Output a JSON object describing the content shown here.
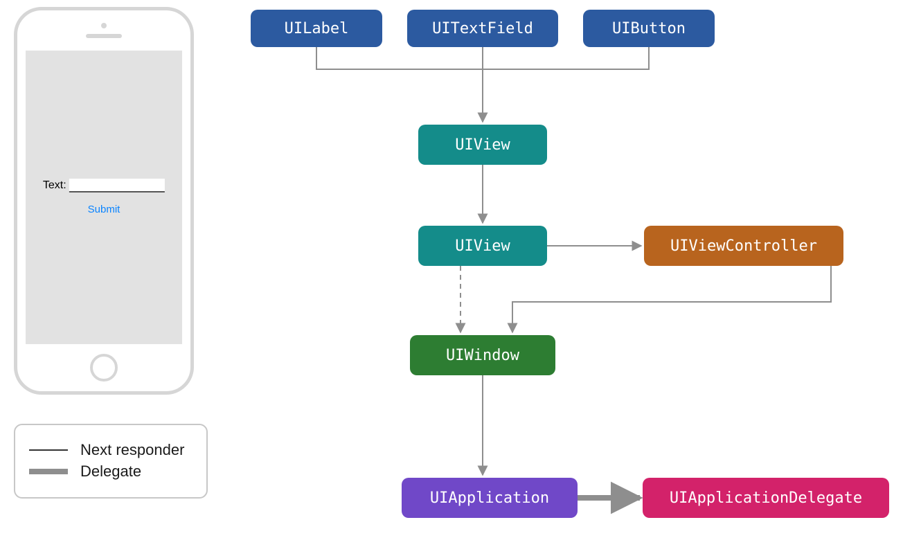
{
  "phone": {
    "label": "Text:",
    "submit": "Submit"
  },
  "legend": {
    "next_responder": "Next responder",
    "delegate": "Delegate"
  },
  "nodes": {
    "uilabel": "UILabel",
    "uitextfield": "UITextField",
    "uibutton": "UIButton",
    "uiview1": "UIView",
    "uiview2": "UIView",
    "uiviewcontroller": "UIViewController",
    "uiwindow": "UIWindow",
    "uiapplication": "UIApplication",
    "uiapplicationdelegate": "UIApplicationDelegate"
  },
  "colors": {
    "blue": "#2c5aa0",
    "teal": "#148c8a",
    "green": "#2d7d32",
    "brown": "#b8641e",
    "purple": "#7048c8",
    "pink": "#d3226a",
    "arrow": "#8e8e8e"
  },
  "edges": [
    {
      "from": "uilabel",
      "to": "uiview1",
      "style": "solid",
      "kind": "next_responder"
    },
    {
      "from": "uitextfield",
      "to": "uiview1",
      "style": "solid",
      "kind": "next_responder"
    },
    {
      "from": "uibutton",
      "to": "uiview1",
      "style": "solid",
      "kind": "next_responder"
    },
    {
      "from": "uiview1",
      "to": "uiview2",
      "style": "solid",
      "kind": "next_responder"
    },
    {
      "from": "uiview2",
      "to": "uiviewcontroller",
      "style": "solid",
      "kind": "next_responder"
    },
    {
      "from": "uiview2",
      "to": "uiwindow",
      "style": "dashed",
      "kind": "next_responder"
    },
    {
      "from": "uiviewcontroller",
      "to": "uiwindow",
      "style": "solid",
      "kind": "next_responder"
    },
    {
      "from": "uiwindow",
      "to": "uiapplication",
      "style": "solid",
      "kind": "next_responder"
    },
    {
      "from": "uiapplication",
      "to": "uiapplicationdelegate",
      "style": "thick",
      "kind": "delegate"
    }
  ]
}
